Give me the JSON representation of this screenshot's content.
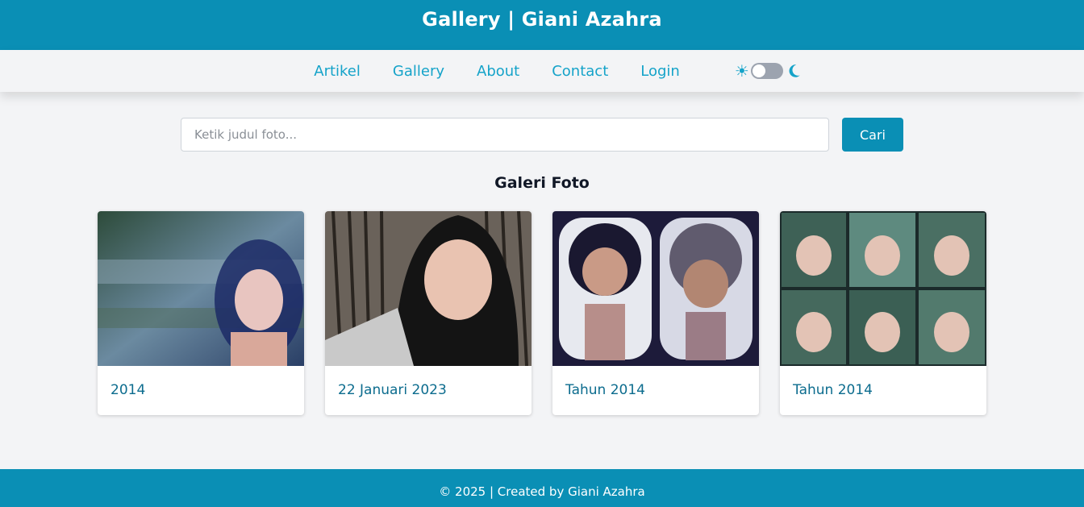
{
  "header": {
    "title": "Gallery | Giani Azahra"
  },
  "nav": {
    "items": [
      {
        "label": "Artikel"
      },
      {
        "label": "Gallery"
      },
      {
        "label": "About"
      },
      {
        "label": "Contact"
      },
      {
        "label": "Login"
      }
    ],
    "theme_toggle": {
      "left_icon": "sun-icon",
      "right_icon": "moon-icon",
      "dark_mode_enabled": false
    }
  },
  "search": {
    "placeholder": "Ketik judul foto...",
    "value": "",
    "button_label": "Cari"
  },
  "gallery": {
    "title": "Galeri Foto",
    "cards": [
      {
        "caption": "2014"
      },
      {
        "caption": "22 Januari 2023"
      },
      {
        "caption": "Tahun 2014"
      },
      {
        "caption": "Tahun 2014"
      }
    ]
  },
  "footer": {
    "text": "© 2025 | Created by Giani Azahra"
  },
  "colors": {
    "primary": "#0a8fb5",
    "link": "#15a3c9",
    "caption": "#0c6c8e",
    "background": "#f3f4f6"
  }
}
